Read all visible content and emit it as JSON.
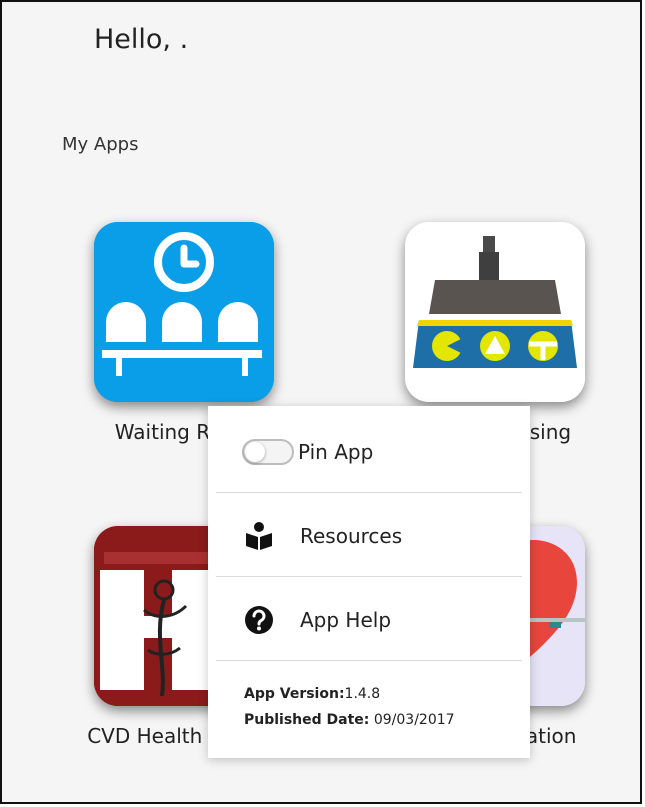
{
  "header": {
    "greeting": "Hello, ."
  },
  "section": {
    "title": "My Apps"
  },
  "apps": [
    {
      "label": "Waiting Room",
      "icon": "waiting-room-icon",
      "color": "#0a9ee8"
    },
    {
      "label": "Data Cleansing",
      "icon": "data-cleansing-icon",
      "color": "#ffffff"
    },
    {
      "label": "CVD Health Tracker",
      "icon": "cvd-health-tracker-icon",
      "color": "#8b1a1a"
    },
    {
      "label": "Atrial Fibrillation",
      "icon": "atrial-fibrillation-icon",
      "color": "#e8e4f8"
    }
  ],
  "menu": {
    "pin": {
      "label": "Pin App",
      "toggle_on": false
    },
    "resources": {
      "label": "Resources",
      "icon": "book-reader-icon"
    },
    "help": {
      "label": "App Help",
      "icon": "question-circle-icon"
    },
    "version_label": "App Version:",
    "version_value": "1.4.8",
    "published_label": "Published Date:",
    "published_value": "09/03/2017"
  }
}
